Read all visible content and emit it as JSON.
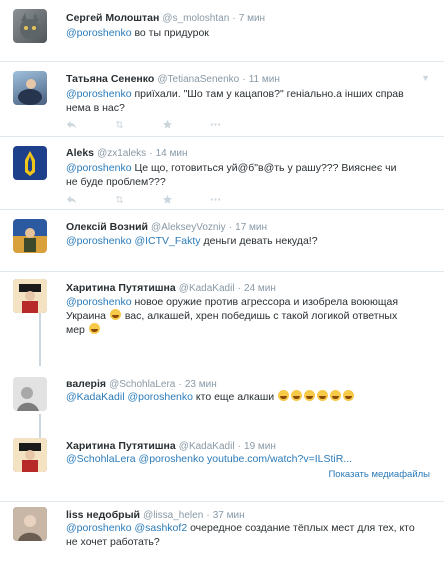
{
  "tweets": [
    {
      "name": "Сергей Молоштан",
      "handle": "@s_moloshtan",
      "time": "7 мин",
      "mention": "@poroshenko",
      "text": " во ты придурок",
      "avatar_colors": [
        "#8c9195",
        "#4f5558"
      ]
    },
    {
      "name": "Татьяна Сененко",
      "handle": "@TetianaSenenko",
      "time": "11 мин",
      "mention": "@poroshenko",
      "text": " приїхали. \"Шо там у кацапов?\" геніально.а інших справ нема в нас?",
      "avatar_colors": [
        "#7fa6c9",
        "#2f3e57"
      ]
    },
    {
      "name": "Aleks",
      "handle": "@zx1aleks",
      "time": "14 мин",
      "mention": "@poroshenko",
      "text": " Це що, готовиться уй@б\"в@ть у рашу??? Вияснеє чи не буде проблем???",
      "avatar_colors": [
        "#1e3f8a",
        "#f0c419"
      ]
    },
    {
      "name": "Олексій Возний",
      "handle": "@AlekseyVozniy",
      "time": "17 мин",
      "mention": "@poroshenko",
      "mention2": "@ICTV_Fakty",
      "text": "  деньги девать некуда!?",
      "avatar_colors": [
        "#d9a13b",
        "#2c5aa0"
      ]
    },
    {
      "name": "Харитина Путятишна",
      "handle": "@KadaKadil",
      "time": "24 мин",
      "mention": "@poroshenko",
      "text_a": " новое оружие против агрессора и изобрела воюющая Украина ",
      "text_b": " вас, алкашей, хрен победишь с такой логикой ответных",
      "text_c": "мер ",
      "avatar_colors": [
        "#b82a2a",
        "#1a1a1a"
      ]
    },
    {
      "name": "валерія",
      "handle": "@SchohlaLera",
      "time": "23 мин",
      "mention": "@KadaKadil",
      "mention2": "@poroshenko",
      "text": " кто еще алкаши ",
      "avatar_colors": [
        "#d8d8d8",
        "#8a8a8a"
      ]
    },
    {
      "name": "Харитина Путятишна",
      "handle": "@KadaKadil",
      "time": "19 мин",
      "mention": "@SchohlaLera",
      "mention2": "@poroshenko",
      "link": "youtube.com/watch?v=ILStiR...",
      "media_label": "Показать медиафайлы",
      "avatar_colors": [
        "#b82a2a",
        "#1a1a1a"
      ]
    },
    {
      "name": "liss недобрый",
      "handle": "@lissa_helen",
      "time": "37 мин",
      "mention": "@poroshenko",
      "mention2": "@sashkof2",
      "text": " очередное создание тёплых мест для тех, кто не хочет работать?",
      "avatar_colors": [
        "#6b5d52",
        "#c8b7a6"
      ]
    }
  ],
  "separator": "·",
  "emoji_name": "face-with-tears-of-joy"
}
